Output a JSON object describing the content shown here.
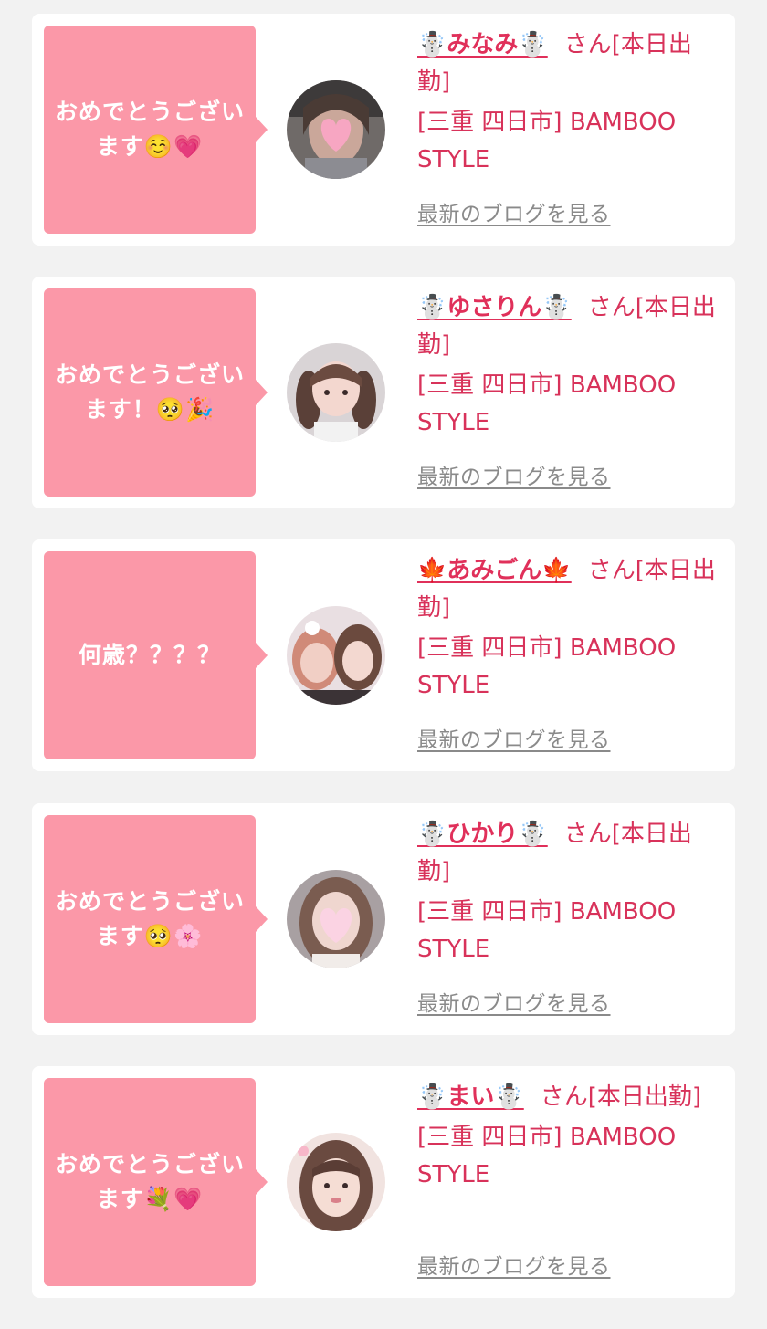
{
  "feed": {
    "entries": [
      {
        "message": "おめでとうござい\nます☺️💗",
        "girl_name": "☃️みなみ☃️",
        "status": "さん[本日出勤]",
        "shop": "[三重 四日市] BAMBOO STYLE",
        "blog_link": "最新のブログを見る",
        "avatar_icon": "avatar-heart-masked-photo"
      },
      {
        "message": "おめでとうござい\nます！🥺🎉",
        "girl_name": "☃️ゆさりん☃️",
        "status": "さん[本日出勤]",
        "shop": "[三重 四日市] BAMBOO STYLE",
        "blog_link": "最新のブログを見る",
        "avatar_icon": "avatar-twin-tails-photo"
      },
      {
        "message": "何歳？？？？",
        "girl_name": "🍁あみごん🍁",
        "status": "さん[本日出勤]",
        "shop": "[三重 四日市] BAMBOO STYLE",
        "blog_link": "最新のブログを見る",
        "avatar_icon": "avatar-two-girls-photo"
      },
      {
        "message": "おめでとうござい\nます🥺🌸",
        "girl_name": "☃️ひかり☃️",
        "status": "さん[本日出勤]",
        "shop": "[三重 四日市] BAMBOO STYLE",
        "blog_link": "最新のブログを見る",
        "avatar_icon": "avatar-heart-masked-photo"
      },
      {
        "message": "おめでとうござい\nます💐💗",
        "girl_name": "☃️まい☃️",
        "status": "さん[本日出勤]",
        "shop": "[三重 四日市] BAMBOO STYLE",
        "blog_link": "最新のブログを見る",
        "avatar_icon": "avatar-portrait-photo"
      }
    ]
  },
  "colors": {
    "page_background": "#f2f2f2",
    "card_background": "#ffffff",
    "bubble_pink": "#fb98a8",
    "accent_text": "#d8325a",
    "link_gray": "#8a8a8a"
  }
}
